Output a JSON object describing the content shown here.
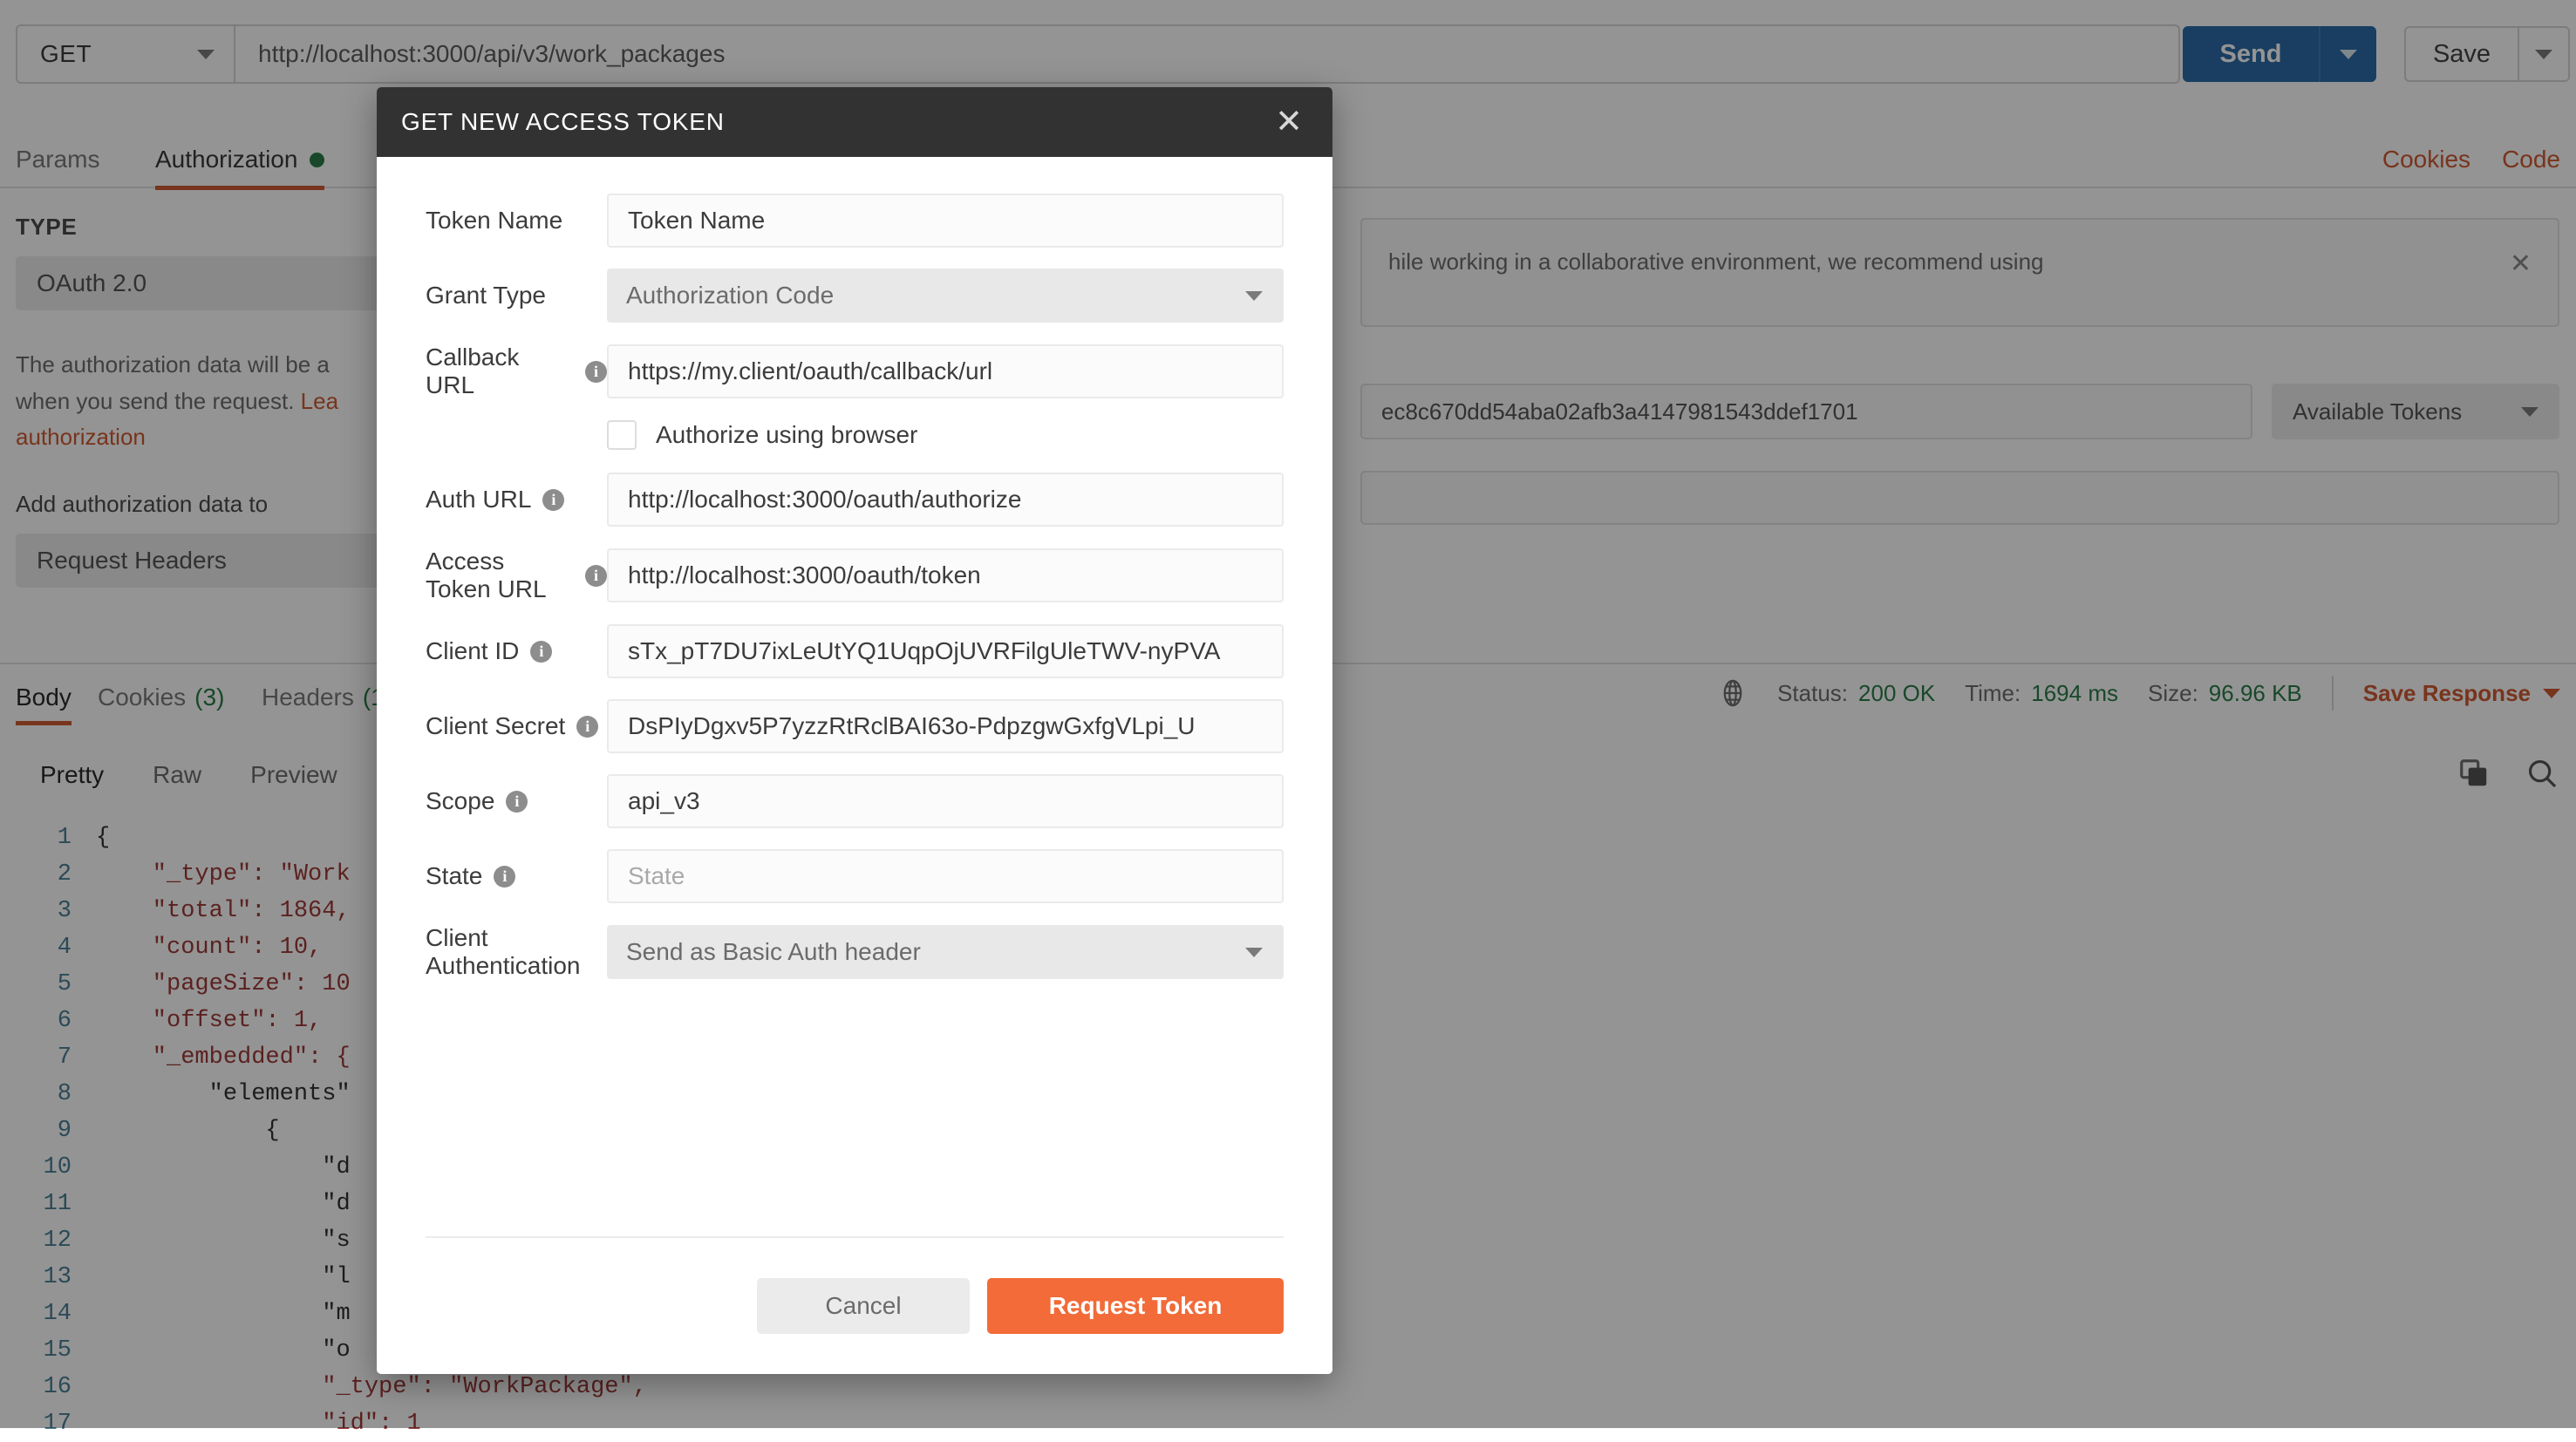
{
  "request_bar": {
    "method": "GET",
    "url": "http://localhost:3000/api/v3/work_packages",
    "send_label": "Send",
    "save_label": "Save"
  },
  "request_tabs": {
    "items": [
      {
        "label": "Params",
        "active": false
      },
      {
        "label": "Authorization",
        "active": true,
        "has_dot": true
      }
    ],
    "right_links": [
      "Cookies",
      "Code"
    ]
  },
  "auth_panel": {
    "type_heading": "TYPE",
    "type_value": "OAuth 2.0",
    "description_before": "The authorization data will be a",
    "description_mid": "when you send the request. ",
    "description_link": "Lea",
    "description_link2": "authorization",
    "add_data_label": "Add authorization data to",
    "add_data_value": "Request Headers",
    "banner_text": "hile working in a collaborative environment, we recommend using",
    "banner_close": "✕",
    "access_token_value": "ec8c670dd54aba02afb3a4147981543ddef1701",
    "available_tokens_label": "Available Tokens"
  },
  "response": {
    "tabs": [
      {
        "label": "Body",
        "count": "",
        "active": true
      },
      {
        "label": "Cookies",
        "count": "(3)",
        "active": false
      },
      {
        "label": "Headers",
        "count": "(1",
        "active": false
      }
    ],
    "status_label": "Status:",
    "status_value": "200 OK",
    "time_label": "Time:",
    "time_value": "1694 ms",
    "size_label": "Size:",
    "size_value": "96.96 KB",
    "save_response_label": "Save Response",
    "view_modes": [
      {
        "label": "Pretty",
        "active": true
      },
      {
        "label": "Raw",
        "active": false
      },
      {
        "label": "Preview",
        "active": false
      }
    ],
    "body_lines": [
      {
        "n": "1",
        "text": "{"
      },
      {
        "n": "2",
        "text": "    \"_type\": \"Work"
      },
      {
        "n": "3",
        "text": "    \"total\": 1864,"
      },
      {
        "n": "4",
        "text": "    \"count\": 10,"
      },
      {
        "n": "5",
        "text": "    \"pageSize\": 10"
      },
      {
        "n": "6",
        "text": "    \"offset\": 1,"
      },
      {
        "n": "7",
        "text": "    \"_embedded\": {"
      },
      {
        "n": "8",
        "text": "        \"elements\""
      },
      {
        "n": "9",
        "text": "            {"
      },
      {
        "n": "10",
        "text": "                \"d"
      },
      {
        "n": "11",
        "text": "                \"d"
      },
      {
        "n": "12",
        "text": "                \"s"
      },
      {
        "n": "13",
        "text": "                \"l"
      },
      {
        "n": "14",
        "text": "                \"m"
      },
      {
        "n": "15",
        "text": "                \"o"
      },
      {
        "n": "16",
        "text": "                \"_type\": \"WorkPackage\","
      },
      {
        "n": "17",
        "text": "                \"id\": 1"
      }
    ]
  },
  "modal": {
    "title": "GET NEW ACCESS TOKEN",
    "close_icon": "✕",
    "fields": [
      {
        "label": "Token Name",
        "info": false,
        "kind": "input",
        "value": "Token Name",
        "placeholder": ""
      },
      {
        "label": "Grant Type",
        "info": false,
        "kind": "select",
        "value": "Authorization Code"
      },
      {
        "label": "Callback URL",
        "info": true,
        "kind": "input",
        "value": "https://my.client/oauth/callback/url"
      },
      {
        "label": "Auth URL",
        "info": true,
        "kind": "input",
        "value": "http://localhost:3000/oauth/authorize"
      },
      {
        "label": "Access Token URL",
        "info": true,
        "kind": "input",
        "value": "http://localhost:3000/oauth/token"
      },
      {
        "label": "Client ID",
        "info": true,
        "kind": "input",
        "value": "sTx_pT7DU7ixLeUtYQ1UqpOjUVRFilgUleTWV-nyPVA"
      },
      {
        "label": "Client Secret",
        "info": true,
        "kind": "input",
        "value": "DsPIyDgxv5P7yzzRtRclBAI63o-PdpzgwGxfgVLpi_U"
      },
      {
        "label": "Scope",
        "info": true,
        "kind": "input",
        "value": "api_v3"
      },
      {
        "label": "State",
        "info": true,
        "kind": "input",
        "value": "",
        "placeholder": "State"
      },
      {
        "label": "Client Authentication",
        "info": false,
        "kind": "select",
        "value": "Send as Basic Auth header"
      }
    ],
    "checkbox_label": "Authorize using browser",
    "checkbox_checked": false,
    "cancel_label": "Cancel",
    "request_token_label": "Request Token"
  },
  "colors": {
    "accent_orange": "#f26b38",
    "link_orange": "#cf5b33",
    "send_blue": "#2b6ca8",
    "status_green": "#2a7c48",
    "modal_header": "#323232"
  }
}
